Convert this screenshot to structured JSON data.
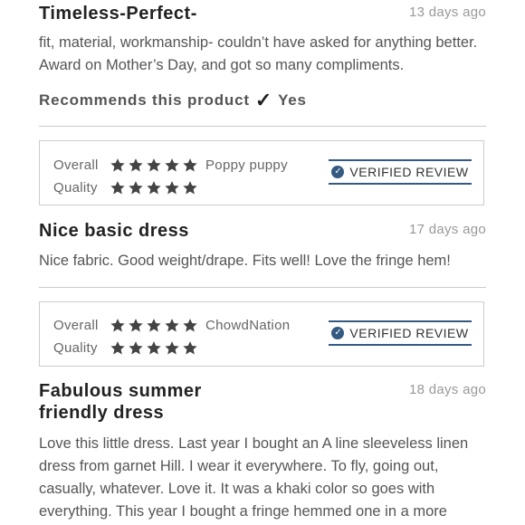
{
  "reviews": [
    {
      "title": "Timeless-Perfect-",
      "date": "13 days ago",
      "body": "fit, material, workmanship- couldn’t have asked for anything better. Award on Mother’s Day, and got so many compliments.",
      "recommends_label": "Recommends this product",
      "recommends_value": "Yes"
    },
    {
      "title": "Nice basic dress",
      "date": "17 days ago",
      "body": "Nice fabric. Good weight/drape. Fits well! Love the fringe hem!"
    },
    {
      "title": "Fabulous summer friendly dress",
      "date": "18 days ago",
      "body": "Love this little dress. Last year I bought an A line sleeveless linen dress from garnet Hill. I wear it everywhere. To fly, going out, casually, whatever. Love it. It was a khaki color so goes with everything. This year I bought a fringe hemmed one in a more"
    }
  ],
  "ratings": [
    {
      "overall_label": "Overall",
      "quality_label": "Quality",
      "overall_stars": 5,
      "quality_stars": 5,
      "reviewer": "Poppy puppy",
      "verified": "VERIFIED REVIEW"
    },
    {
      "overall_label": "Overall",
      "quality_label": "Quality",
      "overall_stars": 5,
      "quality_stars": 5,
      "reviewer": "ChowdNation",
      "verified": "VERIFIED REVIEW"
    }
  ],
  "colors": {
    "star": "#444444",
    "verified_accent": "#345a82",
    "divider": "#cccccc"
  },
  "icons": {
    "check": "checkmark-icon",
    "star": "star-icon",
    "verified": "verified-check-icon"
  }
}
